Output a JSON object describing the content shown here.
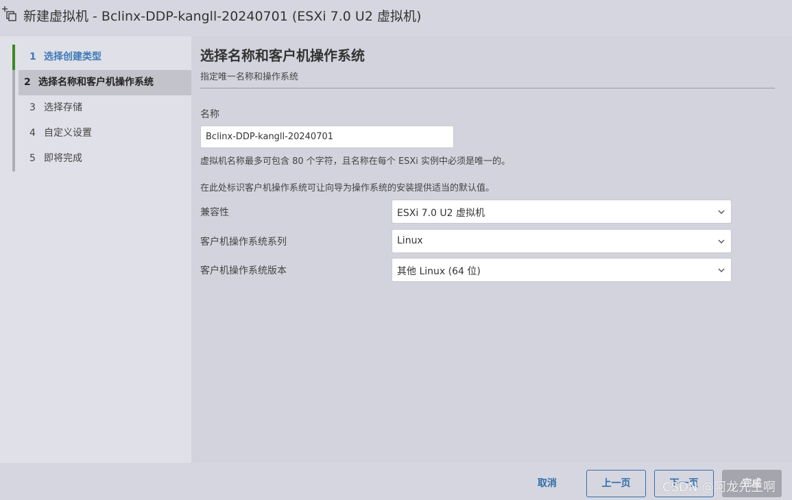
{
  "window": {
    "title": "新建虚拟机 - Bclinx-DDP-kangll-20240701 (ESXi 7.0 U2 虚拟机)",
    "icon": "new-vm-icon"
  },
  "sidebar": {
    "steps": [
      {
        "num": "1",
        "label": "选择创建类型",
        "state": "done"
      },
      {
        "num": "2",
        "label": "选择名称和客户机操作系统",
        "state": "active"
      },
      {
        "num": "3",
        "label": "选择存储",
        "state": "pending"
      },
      {
        "num": "4",
        "label": "自定义设置",
        "state": "pending"
      },
      {
        "num": "5",
        "label": "即将完成",
        "state": "pending"
      }
    ]
  },
  "main": {
    "title": "选择名称和客户机操作系统",
    "subtitle": "指定唯一名称和操作系统",
    "name_label": "名称",
    "name_value": "Bclinx-DDP-kangll-20240701",
    "name_hint": "虚拟机名称最多可包含 80 个字符，且名称在每个 ESXi 实例中必须是唯一的。",
    "os_intro": "在此处标识客户机操作系统可让向导为操作系统的安装提供适当的默认值。",
    "fields": [
      {
        "label": "兼容性",
        "value": "ESXi 7.0 U2 虚拟机"
      },
      {
        "label": "客户机操作系统系列",
        "value": "Linux"
      },
      {
        "label": "客户机操作系统版本",
        "value": "其他 Linux (64 位)"
      }
    ]
  },
  "footer": {
    "cancel": "取消",
    "back": "上一页",
    "next": "下一页",
    "finish": "完成"
  },
  "watermark": "CSDN @阿龙先生啊",
  "colors": {
    "accent": "#2f6da8",
    "done_step": "#3d7ab8",
    "done_bar": "#3a8a1e",
    "active_step_bg": "#c3c3cc",
    "disabled_button": "#a5a5ae"
  }
}
